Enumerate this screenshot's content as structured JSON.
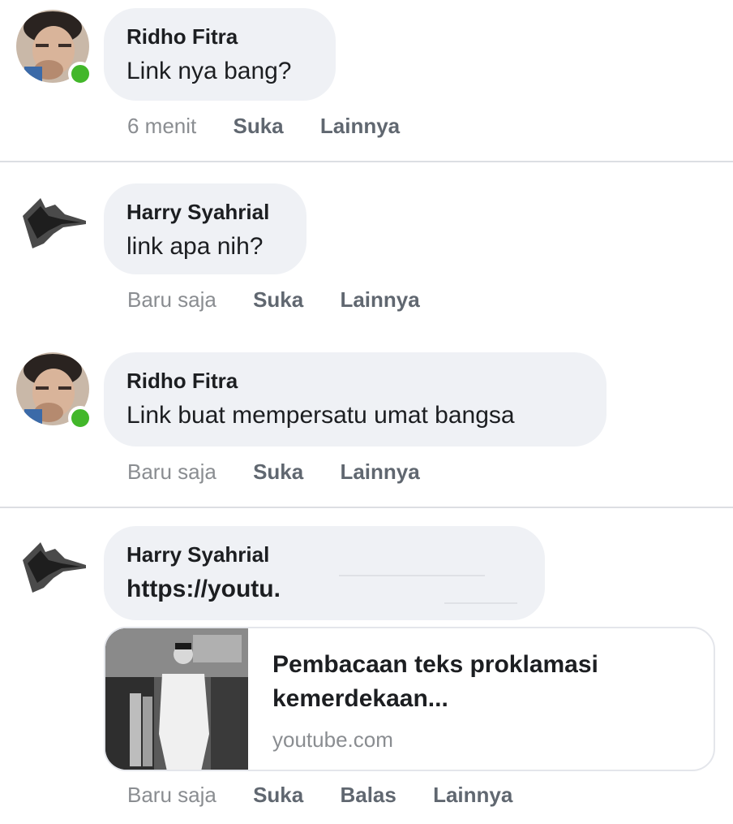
{
  "comments": [
    {
      "author": "Ridho Fitra",
      "text": "Link nya bang?",
      "time": "6 menit",
      "like": "Suka",
      "more": "Lainnya"
    },
    {
      "author": "Harry Syahrial",
      "text": "link apa nih?",
      "time": "Baru saja",
      "like": "Suka",
      "more": "Lainnya"
    },
    {
      "author": "Ridho Fitra",
      "text": "Link buat mempersatu umat bangsa",
      "time": "Baru saja",
      "like": "Suka",
      "more": "Lainnya"
    },
    {
      "author": "Harry Syahrial",
      "text": "https://youtu.",
      "time": "Baru saja",
      "like": "Suka",
      "reply": "Balas",
      "more": "Lainnya",
      "link_preview": {
        "title": "Pembacaan teks proklamasi kemerdekaan...",
        "domain": "youtube.com"
      }
    }
  ],
  "colors": {
    "online": "#42b72a",
    "bubble": "#eff1f5",
    "divider": "#dcdee3"
  },
  "icons": {
    "avatar_ridho": "user-photo-avatar",
    "avatar_harry": "abstract-waveform-avatar",
    "online_indicator": "online-status-dot"
  }
}
